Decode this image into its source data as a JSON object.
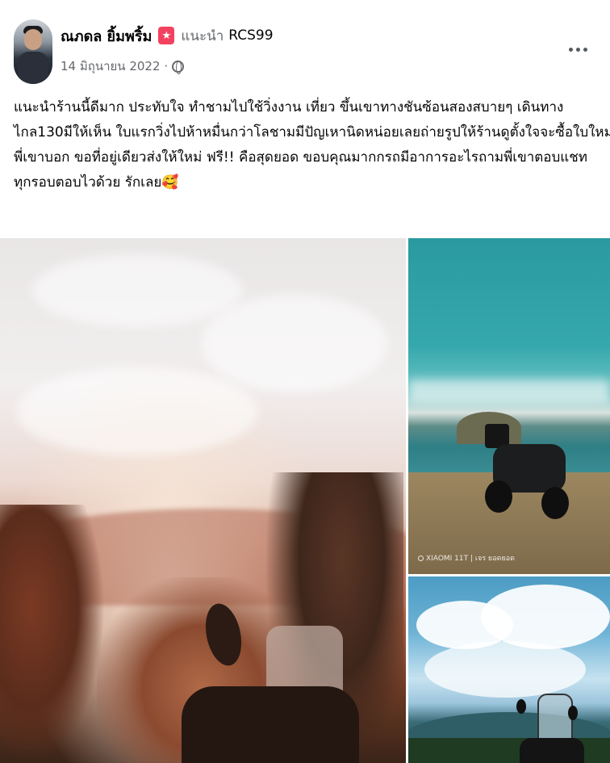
{
  "post": {
    "author_name": "ณภดล ยิ้มพริ้ม",
    "recommend_label": "แนะนำ",
    "page_name": "RCS99",
    "date": "14 มิถุนายน 2022",
    "separator": "·",
    "privacy_icon": "globe-icon",
    "more_icon": "more-horizontal-icon",
    "text_lines": [
      "แนะนำร้านนี้ดีมาก ประทับใจ ทำชามไปใช้วิ่งงาน เที่ยว ขึ้นเขาทางชันซ้อนสองสบายๆ เดินทาง",
      "ไกล130มีให้เห็น ใบแรกวิ่งไปห้าหมื่นกว่าโลชามมีปัญเหานิดหน่อยเลยถ่ายรูปให้ร้านดูตั้งใจจะซื้อใบใหม่",
      "พี่เขาบอก ขอที่อยู่เดียวส่งให้ใหม่ ฟรี!! คือสุดยอด ขอบคุณมากกรถมีอาการอะไรถามพี่เขาตอบแชท",
      "ทุกรอบตอบไวด้วย รักเลย🥰"
    ]
  },
  "photos": {
    "top_right_watermark": "XIAOMI 11T | เจร ยอดยอด"
  },
  "colors": {
    "recommend_badge": "#f3425f",
    "secondary_text": "#65676b",
    "primary_text": "#050505"
  }
}
